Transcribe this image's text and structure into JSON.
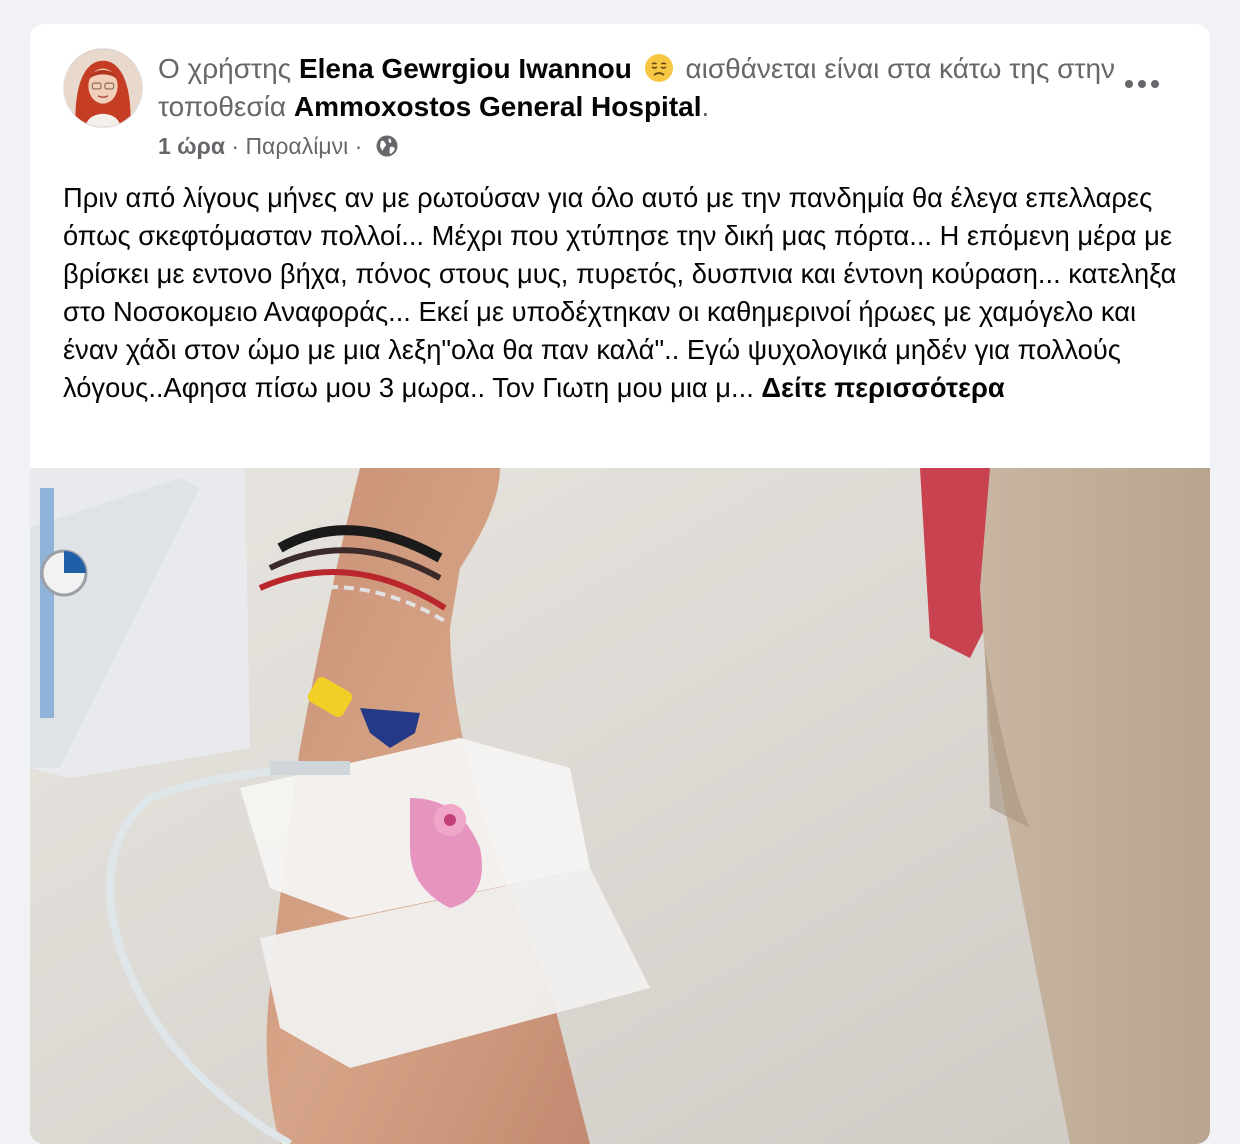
{
  "post": {
    "prefix": "Ο χρήστης",
    "author": "Elena Gewrgiou Iwannou",
    "feeling_text": "αισθάνεται είναι στα κάτω της στην τοποθεσία",
    "feeling_icon": "downcast-face-emoji",
    "location": "Ammoxostos General Hospital",
    "period": ".",
    "time": "1 ώρα",
    "separator": " · ",
    "place": "Παραλίμνι",
    "dot": " · ",
    "audience_icon": "globe-icon",
    "body": "Πριν από λίγους μήνες αν με ρωτούσαν για όλο αυτό με την πανδημία θα έλεγα επελλαρες όπως σκεφτόμασταν πολλοί... Μέχρι που χτύπησε την δική μας πόρτα... Η επόμενη μέρα με βρίσκει με εντονο βήχα, πόνος στους μυς, πυρετός, δυσπνια και έντονη κούραση... κατεληξα στο Νοσοκομειο Αναφοράς... Εκεί με υποδέχτηκαν  οι καθημερινοί ήρωες με χαμόγελο και έναν χάδι στον ώμο με μια λεξη\"ολα θα παν καλά\".. Εγώ ψυχολογικά μηδέν για πολλούς λόγους..Αφησα πίσω μου 3 μωρα.. Τον Γιωτη μου μια μ... ",
    "see_more": "Δείτε περισσότερα",
    "more_icon": "more-options-icon"
  },
  "colors": {
    "background": "#f0f2f5",
    "card": "#ffffff",
    "secondary_text": "#65676b",
    "primary_text": "#050505"
  }
}
